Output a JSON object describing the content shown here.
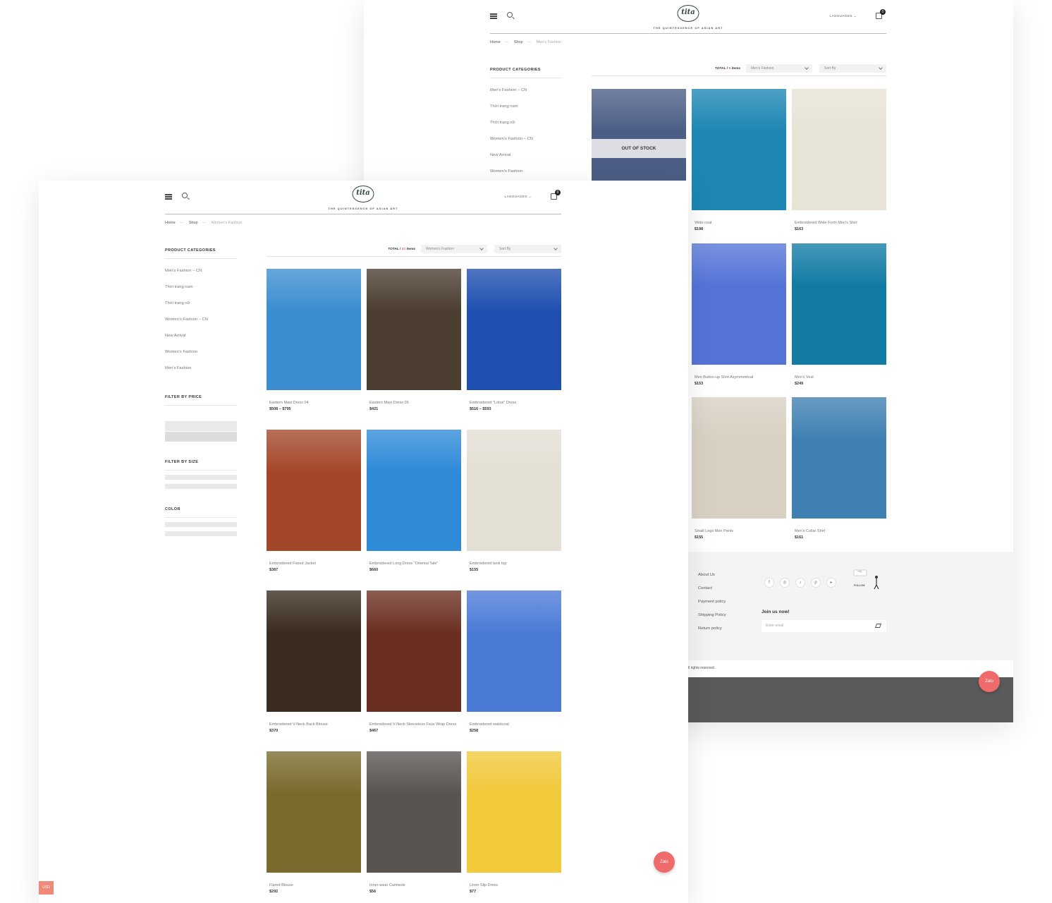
{
  "back": {
    "header": {
      "logo": "tita",
      "tagline": "THE QUINTESSENCE OF ASIAN ART",
      "languages": "LANGUAGES",
      "cart_count": "0"
    },
    "breadcrumb": [
      "Home",
      "Shop",
      "Men's Fashion"
    ],
    "sidebar": {
      "heading": "PRODUCT CATEGORIES",
      "categories": [
        "Men's Fashion – CN",
        "Thời trang nam",
        "Thời trang nữ",
        "Women's Fashion – CN",
        "New Arrival",
        "Women's Fashion"
      ]
    },
    "toolbar": {
      "total_label": "TOTAL",
      "total_count": "9",
      "items_label": "items",
      "category_select": "Men's Fashion",
      "sort_select": "Sort By"
    },
    "products": [
      {
        "name": "",
        "price": "",
        "badge": "OUT OF STOCK",
        "color": "#4c5e86"
      },
      {
        "name": "Wide coat",
        "price": "$198",
        "badge": "",
        "color": "#1d86b4"
      },
      {
        "name": "Embroidered Wide Form Men's Shirt",
        "price": "$163",
        "badge": "",
        "color": "#e8e3d7"
      },
      {
        "name": "Men Button-up Shirt Asymmetrical",
        "price": "$153",
        "badge": "",
        "color": "#5474d8"
      },
      {
        "name": "Men's Vest",
        "price": "$249",
        "badge": "",
        "color": "#117ba4"
      },
      {
        "name": "Small Legs Men Pants",
        "price": "$155",
        "badge": "",
        "color": "#d8d1c3"
      },
      {
        "name": "Men's Collar Shirt",
        "price": "$161",
        "badge": "",
        "color": "#3f80b3"
      }
    ],
    "footer": {
      "links": [
        "About Us",
        "Contact",
        "Payment policy",
        "Shipping Policy",
        "Return policy"
      ],
      "social_icons": [
        "facebook-icon",
        "instagram-icon",
        "tiktok-icon",
        "pinterest-icon",
        "youtube-icon"
      ],
      "join": "Join us now!",
      "email_placeholder": "Enter email",
      "follow": "FOLLOW",
      "copyright": "ll rights reserved."
    },
    "zalo": "Zalo"
  },
  "front": {
    "header": {
      "logo": "tita",
      "tagline": "THE QUINTESSENCE OF ASIAN ART",
      "languages": "LANGUAGES",
      "cart_count": "0"
    },
    "breadcrumb": [
      "Home",
      "Shop",
      "Women's Fashion"
    ],
    "sidebar": {
      "heading": "PRODUCT CATEGORIES",
      "categories": [
        "Men's Fashion – CN",
        "Thời trang nam",
        "Thời trang nữ",
        "Women's Fashion – CN",
        "New Arrival",
        "Women's Fashion",
        "Men's Fashion"
      ],
      "filter_price": "FILTER BY PRICE",
      "filter_size": "FILTER BY SIZE",
      "color": "COLOR"
    },
    "toolbar": {
      "total_label": "TOTAL",
      "total_count": "41",
      "items_label": "items",
      "category_select": "Women's Fashion",
      "sort_select": "Sort By"
    },
    "products": [
      {
        "name": "Eastern Maxi Dress 04",
        "price": "$508 – $795",
        "color": "#3b8ed0"
      },
      {
        "name": "Eastern Maxi Dress 05",
        "price": "$421",
        "color": "#4b3d30"
      },
      {
        "name": "Embroidered \"Lotus\" Dress",
        "price": "$516 – $593",
        "color": "#1f4fb0"
      },
      {
        "name": "Embroidered Flared Jacket",
        "price": "$387",
        "color": "#a3472a"
      },
      {
        "name": "Embroidered Long Dress \"Oriental Tale\"",
        "price": "$660",
        "color": "#2f8ad8"
      },
      {
        "name": "Embroidered tank top",
        "price": "$155",
        "color": "#e4dfd5"
      },
      {
        "name": "Embroidered V-Neck Back Blouse",
        "price": "$370",
        "color": "#3a2c1e"
      },
      {
        "name": "Embroidered V-Neck Sleeveless Faux Wrap Dress",
        "price": "$467",
        "color": "#6b2f22"
      },
      {
        "name": "Embroidered waistcoat",
        "price": "$258",
        "color": "#4b7ad6"
      },
      {
        "name": "Flared Blouse",
        "price": "$292",
        "color": "#7a6a2e"
      },
      {
        "name": "Inner-wear Camisole",
        "price": "$56",
        "color": "#5a5450"
      },
      {
        "name": "Linen Slip Dress",
        "price": "$77",
        "color": "#f1c93a"
      }
    ],
    "zalo": "Zalo",
    "currency": "USD"
  }
}
